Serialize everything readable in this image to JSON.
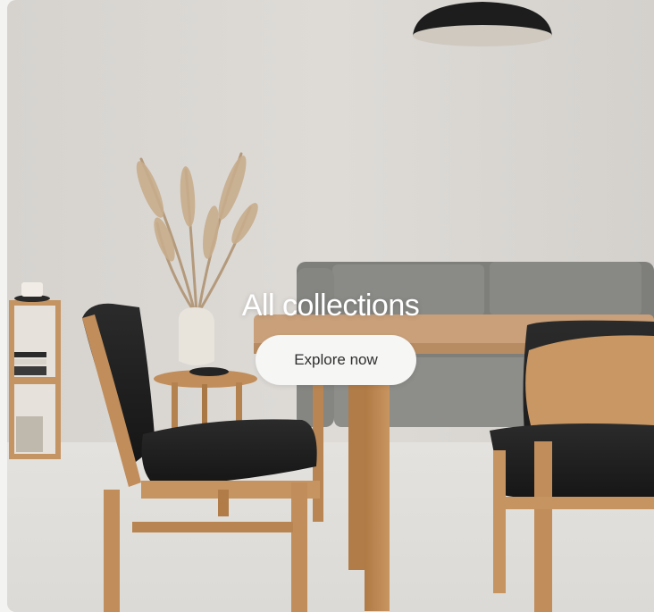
{
  "hero": {
    "title": "All collections",
    "cta_label": "Explore now",
    "image_subject": "minimal dining room with wooden chairs, table, grey sofa, pampas vase and pendant lamp"
  }
}
